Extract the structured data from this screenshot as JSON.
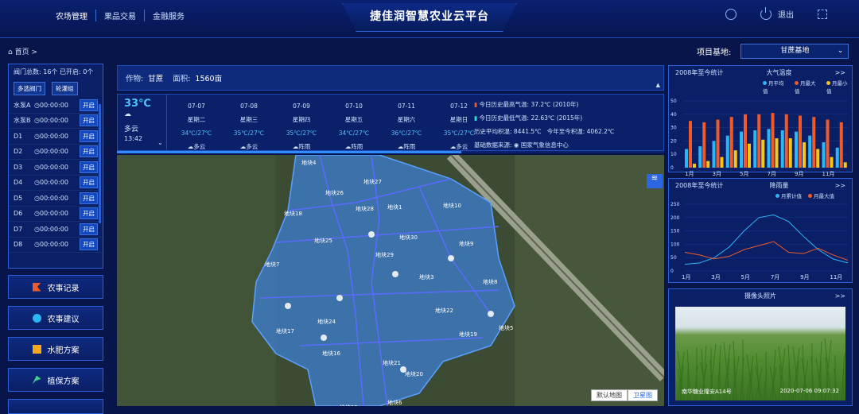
{
  "header": {
    "nav": [
      "农场管理",
      "果品交易",
      "金融服务"
    ],
    "title": "捷佳润智慧农业云平台",
    "logout": "退出"
  },
  "breadcrumb": {
    "home": "首页",
    "sep": ">"
  },
  "base": {
    "label": "项目基地:",
    "value": "甘蔗基地"
  },
  "valves": {
    "total": "阀门总数: 16个",
    "open": "已开启: 0个",
    "btn_multi": "多选阀门",
    "btn_rotate": "轮灌组",
    "rows": [
      {
        "n": "水泵A",
        "t": "00:00:00"
      },
      {
        "n": "水泵B",
        "t": "00:00:00"
      },
      {
        "n": "D1",
        "t": "00:00:00"
      },
      {
        "n": "D2",
        "t": "00:00:00"
      },
      {
        "n": "D3",
        "t": "00:00:00"
      },
      {
        "n": "D4",
        "t": "00:00:00"
      },
      {
        "n": "D5",
        "t": "00:00:00"
      },
      {
        "n": "D6",
        "t": "00:00:00"
      },
      {
        "n": "D7",
        "t": "00:00:00"
      },
      {
        "n": "D8",
        "t": "00:00:00"
      }
    ],
    "open_label": "开启"
  },
  "menu": [
    "农事记录",
    "农事建议",
    "水肥方案",
    "植保方案"
  ],
  "crop": {
    "label": "作物:",
    "name": "甘蔗",
    "area_label": "面积:",
    "area": "1560亩"
  },
  "weather_now": {
    "temp": "33℃",
    "desc": "多云",
    "time": "13:42"
  },
  "forecast": [
    {
      "d": "07-07",
      "w": "星期二",
      "r": "34℃/27℃",
      "c": "多云"
    },
    {
      "d": "07-08",
      "w": "星期三",
      "r": "35℃/27℃",
      "c": "多云"
    },
    {
      "d": "07-09",
      "w": "星期四",
      "r": "35℃/27℃",
      "c": "阵雨"
    },
    {
      "d": "07-10",
      "w": "星期五",
      "r": "34℃/27℃",
      "c": "阵雨"
    },
    {
      "d": "07-11",
      "w": "星期六",
      "r": "36℃/27℃",
      "c": "阵雨"
    },
    {
      "d": "07-12",
      "w": "星期日",
      "r": "35℃/27℃",
      "c": "多云"
    }
  ],
  "history": {
    "max": "今日历史最高气温: 37.2℃ (2010年)",
    "min": "今日历史最低气温: 22.63℃ (2015年)",
    "avg": "历史平均积温: 8441.5℃",
    "year": "今年至今积温: 4062.2℃",
    "src_label": "基础数据来源:",
    "src": "国家气象信息中心"
  },
  "map": {
    "plots": [
      "地块4",
      "地块26",
      "地块27",
      "地块1",
      "地块10",
      "地块18",
      "地块28",
      "地块25",
      "地块30",
      "地块9",
      "地块7",
      "地块29",
      "地块3",
      "地块8",
      "地块22",
      "地块24",
      "地块17",
      "地块19",
      "地块5",
      "地块16",
      "地块21",
      "地块20",
      "地块15",
      "地块6"
    ],
    "btn_default": "默认地图",
    "btn_sat": "卫星图"
  },
  "temp_chart": {
    "range": "2008年至今统计",
    "title": "大气温度",
    "legend": [
      "月平均值",
      "月最大值",
      "月最小值"
    ],
    "colors": [
      "#2db6f5",
      "#f05a28",
      "#f5c518"
    ]
  },
  "rain_chart": {
    "range": "2008年至今统计",
    "title": "降雨量",
    "legend": [
      "月累计值",
      "月最大值"
    ],
    "colors": [
      "#2db6f5",
      "#f05a28"
    ]
  },
  "camera": {
    "title": "摄像头照片",
    "more": ">>",
    "loc": "南华糖业隆安A14号",
    "time": "2020-07-06 09:07:32"
  },
  "more": ">>",
  "chart_data": [
    {
      "type": "bar",
      "title": "大气温度",
      "categories": [
        "1月",
        "2月",
        "3月",
        "4月",
        "5月",
        "6月",
        "7月",
        "8月",
        "9月",
        "10月",
        "11月",
        "12月"
      ],
      "x_tick_labels": [
        "1月",
        "3月",
        "5月",
        "7月",
        "9月",
        "11月"
      ],
      "ylim": [
        0,
        50
      ],
      "y_ticks": [
        0,
        10,
        20,
        30,
        40,
        50
      ],
      "series": [
        {
          "name": "月平均值",
          "values": [
            14,
            16,
            20,
            24,
            27,
            28,
            29,
            28,
            27,
            24,
            19,
            15
          ]
        },
        {
          "name": "月最大值",
          "values": [
            35,
            34,
            36,
            38,
            40,
            40,
            41,
            40,
            39,
            38,
            36,
            34
          ]
        },
        {
          "name": "月最小值",
          "values": [
            3,
            5,
            8,
            13,
            18,
            21,
            22,
            22,
            19,
            14,
            8,
            4
          ]
        }
      ]
    },
    {
      "type": "line",
      "title": "降雨量",
      "categories": [
        "1月",
        "2月",
        "3月",
        "4月",
        "5月",
        "6月",
        "7月",
        "8月",
        "9月",
        "10月",
        "11月",
        "12月"
      ],
      "x_tick_labels": [
        "1月",
        "3月",
        "5月",
        "7月",
        "9月",
        "11月"
      ],
      "ylim": [
        0,
        250
      ],
      "y_ticks": [
        0,
        50,
        100,
        150,
        200,
        250
      ],
      "series": [
        {
          "name": "月累计值",
          "values": [
            25,
            30,
            50,
            90,
            150,
            200,
            210,
            185,
            130,
            80,
            45,
            30
          ]
        },
        {
          "name": "月最大值",
          "values": [
            70,
            60,
            45,
            55,
            80,
            95,
            110,
            70,
            65,
            85,
            60,
            40
          ]
        }
      ]
    }
  ]
}
